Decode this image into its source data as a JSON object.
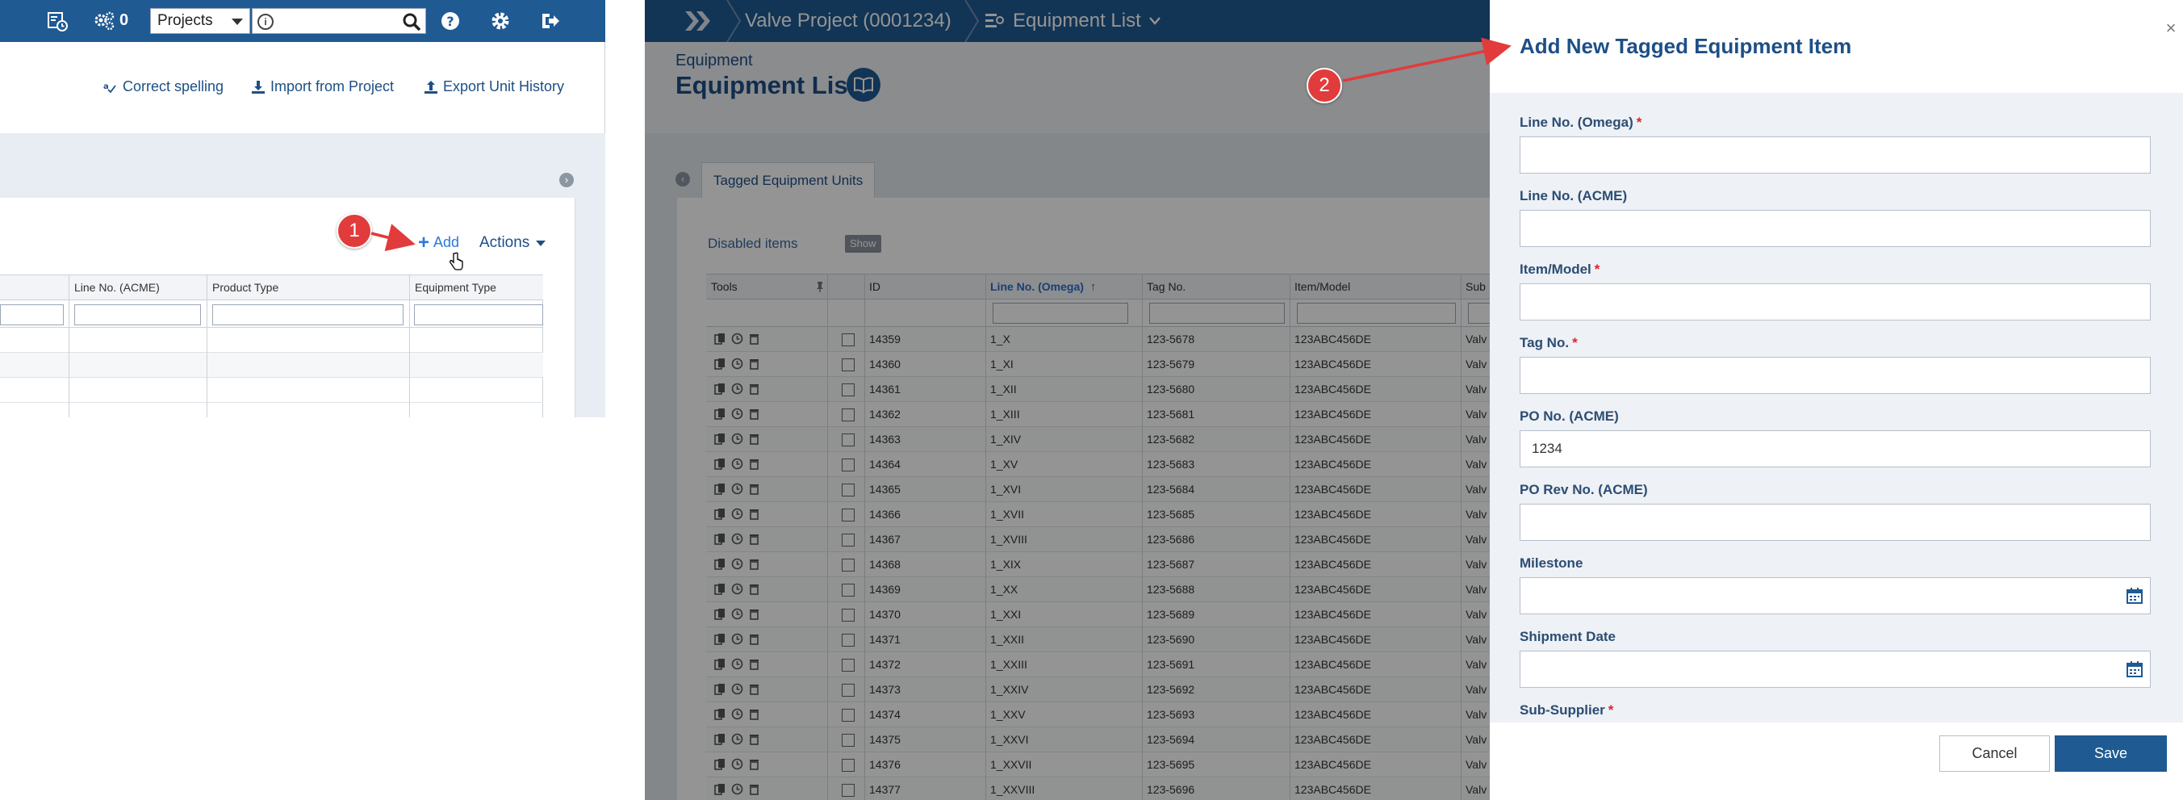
{
  "colors": {
    "brand": "#1f5a93",
    "link": "#2a7ad8",
    "required": "#d9262f",
    "marker": "#e23b3b"
  },
  "left": {
    "topbar": {
      "icons": [
        "dashboard-clock-icon",
        "gears-icon",
        "help-icon",
        "settings-icon",
        "logout-icon"
      ],
      "gear_count": "0",
      "project_select": "Projects",
      "search_placeholder": ""
    },
    "actions": {
      "correct_spelling": "Correct spelling",
      "import_from_project": "Import from Project",
      "export_unit_history": "Export Unit History"
    },
    "marker": "1",
    "add_label": "Add",
    "actions_label": "Actions",
    "grid": {
      "columns": [
        "Line No. (ACME)",
        "Product Type",
        "Equipment Type"
      ],
      "row_count": 3
    }
  },
  "right": {
    "breadcrumb": {
      "project": "Valve Project (0001234)",
      "list": "Equipment List"
    },
    "page_subtitle": "Equipment",
    "page_title": "Equipment List",
    "tab": "Tagged Equipment Units",
    "disabled_items": "Disabled items",
    "show_button": "Show",
    "grid": {
      "columns": [
        "Tools",
        "",
        "ID",
        "Line No. (Omega)",
        "Tag No.",
        "Item/Model",
        "Sub"
      ],
      "rows": [
        {
          "id": "14359",
          "line": "1_X",
          "tag": "123-5678",
          "model": "123ABC456DE",
          "sub": "Valv"
        },
        {
          "id": "14360",
          "line": "1_XI",
          "tag": "123-5679",
          "model": "123ABC456DE",
          "sub": "Valv"
        },
        {
          "id": "14361",
          "line": "1_XII",
          "tag": "123-5680",
          "model": "123ABC456DE",
          "sub": "Valv"
        },
        {
          "id": "14362",
          "line": "1_XIII",
          "tag": "123-5681",
          "model": "123ABC456DE",
          "sub": "Valv"
        },
        {
          "id": "14363",
          "line": "1_XIV",
          "tag": "123-5682",
          "model": "123ABC456DE",
          "sub": "Valv"
        },
        {
          "id": "14364",
          "line": "1_XV",
          "tag": "123-5683",
          "model": "123ABC456DE",
          "sub": "Valv"
        },
        {
          "id": "14365",
          "line": "1_XVI",
          "tag": "123-5684",
          "model": "123ABC456DE",
          "sub": "Valv"
        },
        {
          "id": "14366",
          "line": "1_XVII",
          "tag": "123-5685",
          "model": "123ABC456DE",
          "sub": "Valv"
        },
        {
          "id": "14367",
          "line": "1_XVIII",
          "tag": "123-5686",
          "model": "123ABC456DE",
          "sub": "Valv"
        },
        {
          "id": "14368",
          "line": "1_XIX",
          "tag": "123-5687",
          "model": "123ABC456DE",
          "sub": "Valv"
        },
        {
          "id": "14369",
          "line": "1_XX",
          "tag": "123-5688",
          "model": "123ABC456DE",
          "sub": "Valv"
        },
        {
          "id": "14370",
          "line": "1_XXI",
          "tag": "123-5689",
          "model": "123ABC456DE",
          "sub": "Valv"
        },
        {
          "id": "14371",
          "line": "1_XXII",
          "tag": "123-5690",
          "model": "123ABC456DE",
          "sub": "Valv"
        },
        {
          "id": "14372",
          "line": "1_XXIII",
          "tag": "123-5691",
          "model": "123ABC456DE",
          "sub": "Valv"
        },
        {
          "id": "14373",
          "line": "1_XXIV",
          "tag": "123-5692",
          "model": "123ABC456DE",
          "sub": "Valv"
        },
        {
          "id": "14374",
          "line": "1_XXV",
          "tag": "123-5693",
          "model": "123ABC456DE",
          "sub": "Valv"
        },
        {
          "id": "14375",
          "line": "1_XXVI",
          "tag": "123-5694",
          "model": "123ABC456DE",
          "sub": "Valv"
        },
        {
          "id": "14376",
          "line": "1_XXVII",
          "tag": "123-5695",
          "model": "123ABC456DE",
          "sub": "Valv"
        },
        {
          "id": "14377",
          "line": "1_XXVIII",
          "tag": "123-5696",
          "model": "123ABC456DE",
          "sub": "Valv"
        }
      ]
    }
  },
  "modal": {
    "marker": "2",
    "title": "Add New Tagged Equipment Item",
    "fields": [
      {
        "label": "Line No. (Omega)",
        "required": true,
        "value": "",
        "type": "text"
      },
      {
        "label": "Line No. (ACME)",
        "required": false,
        "value": "",
        "type": "text"
      },
      {
        "label": "Item/Model",
        "required": true,
        "value": "",
        "type": "text"
      },
      {
        "label": "Tag No.",
        "required": true,
        "value": "",
        "type": "text"
      },
      {
        "label": "PO No. (ACME)",
        "required": false,
        "value": "1234",
        "type": "text"
      },
      {
        "label": "PO Rev No. (ACME)",
        "required": false,
        "value": "",
        "type": "text"
      },
      {
        "label": "Milestone",
        "required": false,
        "value": "",
        "type": "date"
      },
      {
        "label": "Shipment Date",
        "required": false,
        "value": "",
        "type": "date"
      },
      {
        "label": "Sub-Supplier",
        "required": true,
        "value": "",
        "type": "text"
      }
    ],
    "cancel_label": "Cancel",
    "save_label": "Save"
  }
}
